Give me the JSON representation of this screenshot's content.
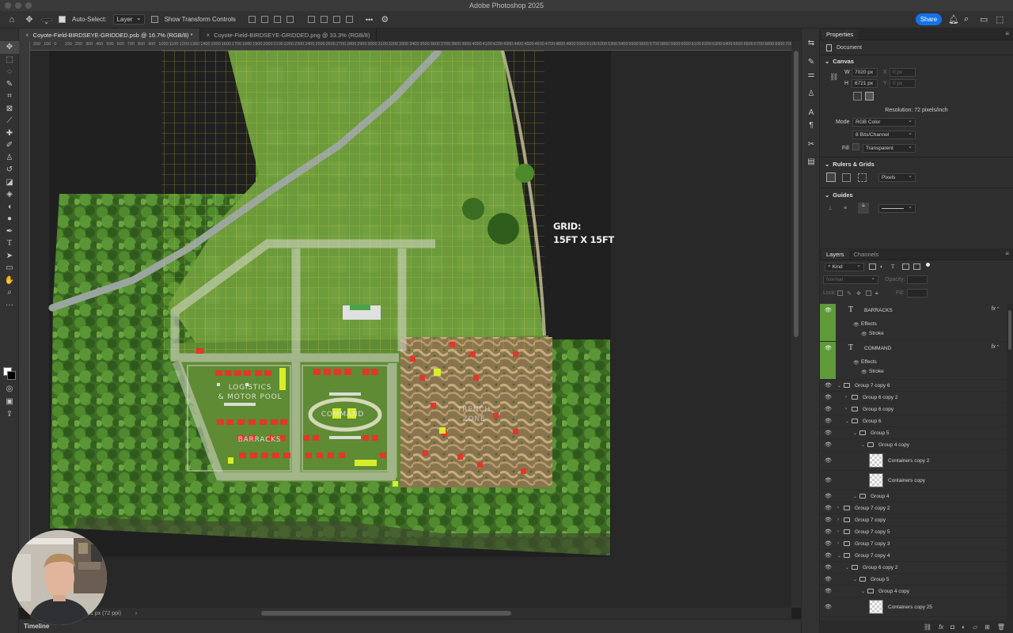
{
  "window": {
    "title": "Adobe Photoshop 2025"
  },
  "options_bar": {
    "auto_select_label": "Auto-Select:",
    "auto_select_value": "Layer",
    "show_transform_label": "Show Transform Controls",
    "more_label": "•••",
    "share_label": "Share"
  },
  "tabs": [
    {
      "label": "Coyote-Field-BIRDSEYE-GRIDDED.psb @ 16.7% (RGB/8) *"
    },
    {
      "label": "Coyote-Field-BIRDSEYE-GRIDDED.png @ 33.3% (RGB/8)"
    }
  ],
  "ruler_ticks": [
    "200",
    "100",
    "0",
    "100",
    "200",
    "300",
    "400",
    "500",
    "600",
    "700",
    "800",
    "900",
    "1000",
    "1100",
    "1200",
    "1300",
    "1400",
    "1500",
    "1600",
    "1700",
    "1800",
    "1900",
    "2000",
    "2100",
    "2200",
    "2300",
    "2400",
    "2500",
    "2600",
    "2700",
    "2800",
    "2900",
    "3000",
    "3100",
    "3200",
    "3300",
    "3400",
    "3500",
    "3600",
    "3700",
    "3800",
    "3900",
    "4000",
    "4100",
    "4200",
    "4300",
    "4400",
    "4500",
    "4600",
    "4700",
    "4800",
    "4900",
    "5000",
    "5100",
    "5200",
    "5300",
    "5400",
    "5500",
    "5600",
    "5700",
    "5800",
    "5900",
    "6000",
    "6100",
    "6200",
    "6300",
    "6400",
    "6500",
    "6600",
    "6700",
    "6800",
    "6900",
    "7000",
    "7100"
  ],
  "canvas": {
    "grid_label_line1": "GRID:",
    "grid_label_line2": "15FT X 15FT",
    "label_logistics_1": "LOGISTICS",
    "label_logistics_2": "& MOTOR POOL",
    "label_command": "COMMAND",
    "label_barracks": "BARRACKS",
    "label_trench_1": "TRENCH",
    "label_trench_2": "ZONE"
  },
  "status": {
    "doc_info": "1 px (72 ppi)"
  },
  "timeline": {
    "label": "Timeline"
  },
  "properties": {
    "tab_label": "Properties",
    "document_label": "Document",
    "canvas_title": "Canvas",
    "w_label": "W",
    "w_value": "7020 px",
    "h_label": "H",
    "h_value": "6721 px",
    "x_label": "X",
    "x_value": "0 px",
    "y_label": "Y",
    "y_value": "0 px",
    "resolution": "Resolution: 72 pixels/inch",
    "mode_label": "Mode",
    "mode_value": "RGB Color",
    "bits_value": "8 Bits/Channel",
    "fill_label": "Fill",
    "fill_value": "Transparent",
    "rulers_title": "Rulers & Grids",
    "units_value": "Pixels",
    "guides_title": "Guides"
  },
  "layers_panel": {
    "tab_layers": "Layers",
    "tab_channels": "Channels",
    "kind_label": "Kind",
    "blend_mode": "Normal",
    "opacity_label": "Opacity:",
    "lock_label": "Lock:",
    "fill_label": "Fill:"
  },
  "layers": [
    {
      "type": "text",
      "name": "BARRACKS",
      "effects": "Effects",
      "stroke": "Stroke",
      "indent": 0
    },
    {
      "type": "text",
      "name": "COMMAND",
      "effects": "Effects",
      "stroke": "Stroke",
      "indent": 0
    },
    {
      "type": "group",
      "name": "Group 7 copy 6",
      "expanded": true,
      "indent": 0
    },
    {
      "type": "group",
      "name": "Group 6 copy 2",
      "expanded": false,
      "indent": 1
    },
    {
      "type": "group",
      "name": "Group 6 copy",
      "expanded": false,
      "indent": 1
    },
    {
      "type": "group",
      "name": "Group 6",
      "expanded": true,
      "indent": 1
    },
    {
      "type": "group",
      "name": "Group 5",
      "expanded": true,
      "indent": 2
    },
    {
      "type": "group",
      "name": "Group 4 copy",
      "expanded": true,
      "indent": 3
    },
    {
      "type": "thumb",
      "name": "Containers copy 2",
      "indent": 4
    },
    {
      "type": "thumb",
      "name": "Containers copy",
      "indent": 4
    },
    {
      "type": "group",
      "name": "Group 4",
      "expanded": true,
      "indent": 2
    },
    {
      "type": "group",
      "name": "Group 7 copy 2",
      "expanded": false,
      "indent": 0
    },
    {
      "type": "group",
      "name": "Group 7 copy",
      "expanded": false,
      "indent": 0
    },
    {
      "type": "group",
      "name": "Group 7 copy 5",
      "expanded": false,
      "indent": 0
    },
    {
      "type": "group",
      "name": "Group 7 copy 3",
      "expanded": false,
      "indent": 0
    },
    {
      "type": "group",
      "name": "Group 7 copy 4",
      "expanded": true,
      "indent": 0
    },
    {
      "type": "group",
      "name": "Group 6 copy 2",
      "expanded": true,
      "indent": 1
    },
    {
      "type": "group",
      "name": "Group 5",
      "expanded": true,
      "indent": 2
    },
    {
      "type": "group",
      "name": "Group 4 copy",
      "expanded": true,
      "indent": 3
    },
    {
      "type": "thumb",
      "name": "Containers copy 25",
      "indent": 4
    }
  ]
}
